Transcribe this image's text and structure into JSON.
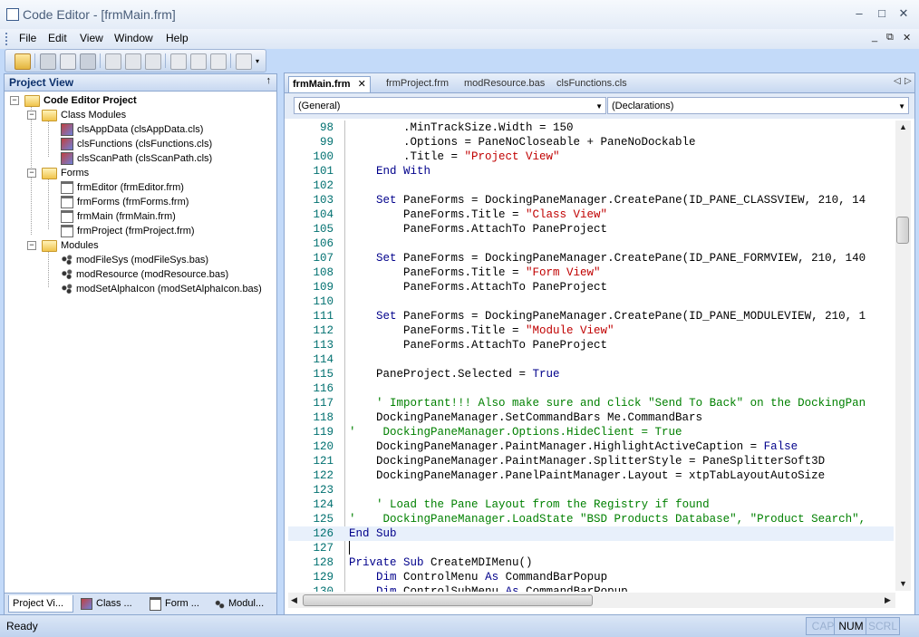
{
  "window": {
    "title": "Code Editor - [frmMain.frm]",
    "minimize": "–",
    "maximize": "□",
    "close": "✕"
  },
  "menu": {
    "items": [
      "File",
      "Edit",
      "View",
      "Window",
      "Help"
    ],
    "mdi_min": "_",
    "mdi_restore": "⧉",
    "mdi_close": "✕"
  },
  "toolbar": {
    "icons": [
      "open-folder-icon",
      "print-icon",
      "print-preview-icon",
      "save-icon",
      "cut-icon",
      "copy-icon",
      "paste-icon",
      "clear-icon",
      "properties-icon",
      "settings-icon",
      "window-icon"
    ]
  },
  "project_view": {
    "title": "Project View",
    "pin": "↑",
    "root": "Code Editor Project",
    "folders": [
      {
        "label": "Class Modules",
        "items": [
          "clsAppData (clsAppData.cls)",
          "clsFunctions (clsFunctions.cls)",
          "clsScanPath (clsScanPath.cls)"
        ]
      },
      {
        "label": "Forms",
        "items": [
          "frmEditor (frmEditor.frm)",
          "frmForms (frmForms.frm)",
          "frmMain (frmMain.frm)",
          "frmProject (frmProject.frm)"
        ]
      },
      {
        "label": "Modules",
        "items": [
          "modFileSys (modFileSys.bas)",
          "modResource (modResource.bas)",
          "modSetAlphaIcon (modSetAlphaIcon.bas)"
        ]
      }
    ],
    "bottom_tabs": [
      "Project Vi...",
      "Class ...",
      "Form ...",
      "Modul..."
    ]
  },
  "editor": {
    "tabs": [
      "frmMain.frm",
      "frmProject.frm",
      "modResource.bas",
      "clsFunctions.cls"
    ],
    "tab_close": "✕",
    "object_combo": "(General)",
    "proc_combo": "(Declarations)",
    "lines": [
      {
        "n": "98",
        "t": "        .MinTrackSize.Width = 150"
      },
      {
        "n": "99",
        "t": "        .Options = PaneNoCloseable + PaneNoDockable"
      },
      {
        "n": "100",
        "t": "        .Title = \"Project View\""
      },
      {
        "n": "101",
        "t": "    End With"
      },
      {
        "n": "102",
        "t": ""
      },
      {
        "n": "103",
        "t": "    Set PaneForms = DockingPaneManager.CreatePane(ID_PANE_CLASSVIEW, 210, 14"
      },
      {
        "n": "104",
        "t": "        PaneForms.Title = \"Class View\""
      },
      {
        "n": "105",
        "t": "        PaneForms.AttachTo PaneProject"
      },
      {
        "n": "106",
        "t": ""
      },
      {
        "n": "107",
        "t": "    Set PaneForms = DockingPaneManager.CreatePane(ID_PANE_FORMVIEW, 210, 140"
      },
      {
        "n": "108",
        "t": "        PaneForms.Title = \"Form View\""
      },
      {
        "n": "109",
        "t": "        PaneForms.AttachTo PaneProject"
      },
      {
        "n": "110",
        "t": ""
      },
      {
        "n": "111",
        "t": "    Set PaneForms = DockingPaneManager.CreatePane(ID_PANE_MODULEVIEW, 210, 1"
      },
      {
        "n": "112",
        "t": "        PaneForms.Title = \"Module View\""
      },
      {
        "n": "113",
        "t": "        PaneForms.AttachTo PaneProject"
      },
      {
        "n": "114",
        "t": ""
      },
      {
        "n": "115",
        "t": "    PaneProject.Selected = True"
      },
      {
        "n": "116",
        "t": ""
      },
      {
        "n": "117",
        "t": "    ' Important!!! Also make sure and click \"Send To Back\" on the DockingPan"
      },
      {
        "n": "118",
        "t": "    DockingPaneManager.SetCommandBars Me.CommandBars"
      },
      {
        "n": "119",
        "t": "'    DockingPaneManager.Options.HideClient = True"
      },
      {
        "n": "120",
        "t": "    DockingPaneManager.PaintManager.HighlightActiveCaption = False"
      },
      {
        "n": "121",
        "t": "    DockingPaneManager.PaintManager.SplitterStyle = PaneSplitterSoft3D"
      },
      {
        "n": "122",
        "t": "    DockingPaneManager.PanelPaintManager.Layout = xtpTabLayoutAutoSize"
      },
      {
        "n": "123",
        "t": ""
      },
      {
        "n": "124",
        "t": "    ' Load the Pane Layout from the Registry if found"
      },
      {
        "n": "125",
        "t": "'    DockingPaneManager.LoadState \"BSD Products Database\", \"Product Search\","
      },
      {
        "n": "126",
        "t": "End Sub"
      },
      {
        "n": "127",
        "t": ""
      },
      {
        "n": "128",
        "t": "Private Sub CreateMDIMenu()"
      },
      {
        "n": "129",
        "t": "    Dim ControlMenu As CommandBarPopup"
      },
      {
        "n": "130",
        "t": "    Dim ControlSubMenu As CommandBarPopup"
      }
    ],
    "colors": {
      "keyword": "#00008b",
      "string": "#c00000",
      "comment": "#008000",
      "linenum": "#007070"
    }
  },
  "status": {
    "text": "Ready",
    "indicators": [
      "CAP",
      "NUM",
      "SCRL"
    ]
  }
}
